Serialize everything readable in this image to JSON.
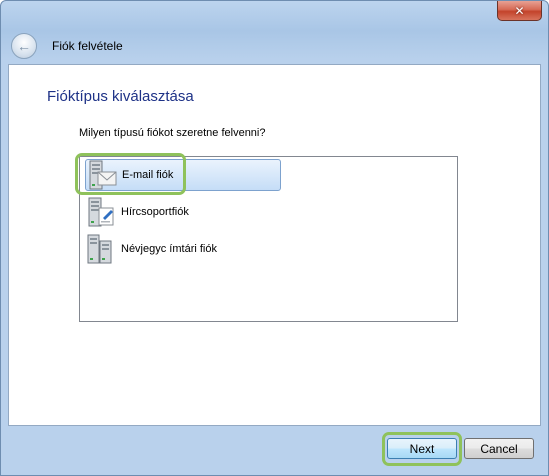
{
  "window": {
    "close_label": "✕"
  },
  "nav": {
    "title": "Fiók felvétele",
    "back_glyph": "←"
  },
  "main": {
    "heading": "Fióktípus kiválasztása",
    "question": "Milyen típusú fiókot szeretne felvenni?",
    "account_types": [
      {
        "label": "E-mail fiók",
        "icon": "email-server-icon",
        "selected": true
      },
      {
        "label": "Hírcsoportfiók",
        "icon": "newsgroup-server-icon",
        "selected": false
      },
      {
        "label": "Névjegyc ímtári fiók",
        "icon": "directory-server-icon",
        "selected": false
      }
    ]
  },
  "footer": {
    "next_label": "Next",
    "cancel_label": "Cancel"
  },
  "colors": {
    "heading": "#1e3287",
    "highlight": "#8fc25b",
    "selection": "#c5ddf7"
  }
}
